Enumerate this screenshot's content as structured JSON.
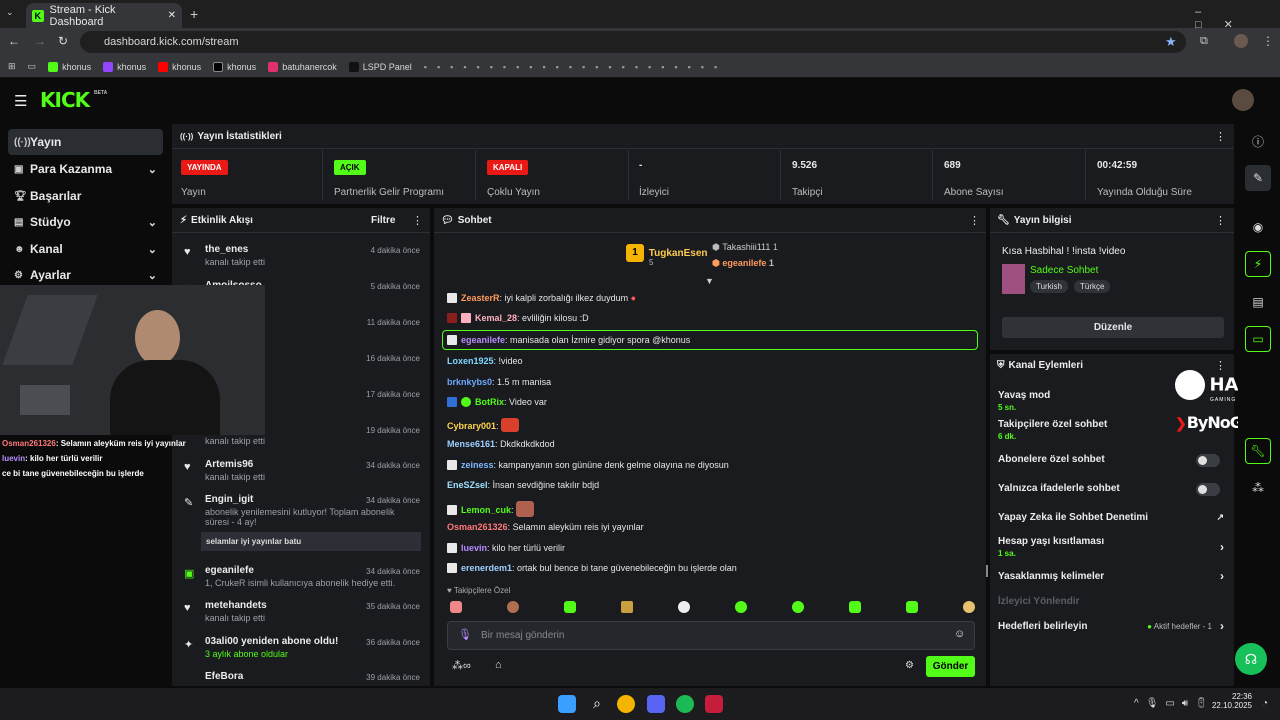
{
  "browser": {
    "tab_title": "Stream - Kick Dashboard",
    "url": "dashboard.kick.com/stream",
    "bookmarks": [
      "khonus",
      "khonus",
      "khonus",
      "khonus",
      "batuhanercok",
      "LSPD Panel"
    ]
  },
  "app": {
    "logo": "KICK",
    "beta": "BETA"
  },
  "sidebar": {
    "items": [
      {
        "label": "Yayın",
        "icon": "broadcast-icon",
        "chev": false
      },
      {
        "label": "Para Kazanma",
        "icon": "money-icon",
        "chev": true
      },
      {
        "label": "Başarılar",
        "icon": "trophy-icon",
        "chev": false
      },
      {
        "label": "Stüdyo",
        "icon": "studio-icon",
        "chev": true
      },
      {
        "label": "Kanal",
        "icon": "user-icon",
        "chev": true
      },
      {
        "label": "Ayarlar",
        "icon": "gear-icon",
        "chev": true
      }
    ]
  },
  "stats": {
    "title": "Yayın İstatistikleri",
    "cards": [
      {
        "badge": "YAYINDA",
        "label": "Yayın",
        "color": "#e91916"
      },
      {
        "badge": "AÇIK",
        "label": "Partnerlik Gelir Programı",
        "color": "#53fc18"
      },
      {
        "badge": "KAPALI",
        "label": "Çoklu Yayın",
        "color": "#e91916"
      },
      {
        "value": "-",
        "label": "İzleyici"
      },
      {
        "value": "9.526",
        "label": "Takipçi"
      },
      {
        "value": "689",
        "label": "Abone Sayısı"
      },
      {
        "value": "00:42:59",
        "label": "Yayında Olduğu Süre"
      }
    ]
  },
  "activity": {
    "title": "Etkinlik Akışı",
    "filter": "Filtre",
    "events": [
      {
        "name": "the_enes",
        "sub": "kanalı takip etti",
        "time": "4 dakika önce",
        "icon": "♥"
      },
      {
        "name": "Amoilsosso",
        "sub": "",
        "time": "5 dakika önce",
        "icon": "♥"
      },
      {
        "name": "",
        "sub": "",
        "time": "11 dakika önce",
        "icon": ""
      },
      {
        "name": "",
        "sub": "",
        "time": "16 dakika önce",
        "icon": ""
      },
      {
        "name": "",
        "sub": "",
        "time": "17 dakika önce",
        "icon": ""
      },
      {
        "name": "",
        "sub": "kanalı takip etti",
        "time": "19 dakika önce",
        "icon": ""
      },
      {
        "name": "Artemis96",
        "sub": "kanalı takip etti",
        "time": "34 dakika önce",
        "icon": "♥"
      },
      {
        "name": "Engin_igit",
        "sub": "abonelik yenilemesini kutluyor! Toplam abonelik süresi - 4 ay!",
        "time": "34 dakika önce",
        "icon": "✎",
        "note": "selamlar iyi yayınlar batu"
      },
      {
        "name": "egeanilefe",
        "sub": "1, CrukeR isimli kullanıcıya abonelik hediye etti.",
        "time": "34 dakika önce",
        "icon": "▣"
      },
      {
        "name": "metehandets",
        "sub": "kanalı takip etti",
        "time": "35 dakika önce",
        "icon": "♥"
      },
      {
        "name": "03ali00 yeniden abone oldu!",
        "sub": "3 aylık abone oldular",
        "time": "36 dakika önce",
        "icon": "✦"
      },
      {
        "name": "EfeBora",
        "sub": "",
        "time": "39 dakika önce",
        "icon": ""
      }
    ]
  },
  "chat": {
    "title": "Sohbet",
    "top": {
      "first": "TugkanEsen",
      "first_count": "5",
      "second": "Takashiii111",
      "second_count": "1",
      "third": "egeanilefe",
      "third_count": "1"
    },
    "messages": [
      {
        "user": "ZeasterR",
        "text": "iyi kalpli zorbalığı ilkez duydum",
        "color": "#ff9b5c"
      },
      {
        "user": "Kemal_28",
        "text": "evliliğin kilosu :D",
        "color": "#ffb0c0"
      },
      {
        "user": "egeanilefe",
        "text": "manisada olan İzmire gidiyor spora @khonus",
        "color": "#b98cff",
        "hl": true
      },
      {
        "user": "Loxen1925",
        "text": "!video",
        "color": "#7fd8ff"
      },
      {
        "user": "brknkybs0",
        "text": "1.5 m manisa",
        "color": "#6ea8ff"
      },
      {
        "user": "BotRix",
        "text": "Video var",
        "color": "#53fc18"
      },
      {
        "user": "Cybrary001",
        "text": "",
        "color": "#ffd34d"
      },
      {
        "user": "Mense6161",
        "text": "Dkdkdkdkdod",
        "color": "#9fd0ff"
      },
      {
        "user": "zeiness",
        "text": "kampanyanın son gününe denk gelme olayına ne diyosun",
        "color": "#7fb8ff"
      },
      {
        "user": "EneSZsel",
        "text": "İnsan sevdiğine takılır bdjd",
        "color": "#9fe0ff"
      },
      {
        "user": "Lemon_cuk",
        "text": "",
        "color": "#53fc18"
      },
      {
        "user": "Osman261326",
        "text": "Selamın aleyküm reis iyi yayınlar",
        "color": "#ff7a7a"
      },
      {
        "user": "luevin",
        "text": "kilo her türlü verilir",
        "color": "#b98cff"
      },
      {
        "user": "erenerdem1",
        "text": "ortak bul bence bi tane güvenebileceğin bu işlerde olan",
        "color": "#9fd0ff"
      }
    ],
    "followers_only": "Takipçilere Özel",
    "placeholder": "Bir mesaj gönderin",
    "send": "Gönder"
  },
  "stream_info": {
    "title": "Yayın bilgisi",
    "stream_title": "Kısa Hasbihal ! !insta !video",
    "category": "Sadece Sohbet",
    "tags": [
      "Turkish",
      "Türkçe"
    ],
    "edit": "Düzenle"
  },
  "channel_actions": {
    "title": "Kanal Eylemleri",
    "items": [
      {
        "label": "Yavaş mod",
        "sub": "5 sn."
      },
      {
        "label": "Takipçilere özel sohbet",
        "sub": "6 dk."
      },
      {
        "label": "Abonelere özel sohbet",
        "toggle": true
      },
      {
        "label": "Yalnızca ifadelerle sohbet",
        "toggle": true
      },
      {
        "label": "Yapay Zeka ile Sohbet Denetimi"
      },
      {
        "label": "Hesap yaşı kısıtlaması",
        "sub": "1 sa."
      },
      {
        "label": "Yasaklanmış kelimeler"
      },
      {
        "label": "İzleyici Yönlendir",
        "disabled": true
      },
      {
        "label": "Hedefleri belirleyin",
        "extra": "Aktif hedefler - 1"
      }
    ]
  },
  "overlay": {
    "brand1": "HAWK",
    "brand1_sub": "GAMING CHAIR",
    "brand2": "ByNoGame",
    "chat": [
      {
        "user": "Osman261326",
        "text": ": Selamın aleyküm reis iyi yayınlar"
      },
      {
        "user": "luevin",
        "text": ": kilo her türlü verilir"
      },
      {
        "user": "",
        "text": "ce bi tane güvenebileceğin bu işlerde"
      }
    ]
  },
  "taskbar": {
    "time": "22:36",
    "date": "22.10.2025"
  }
}
